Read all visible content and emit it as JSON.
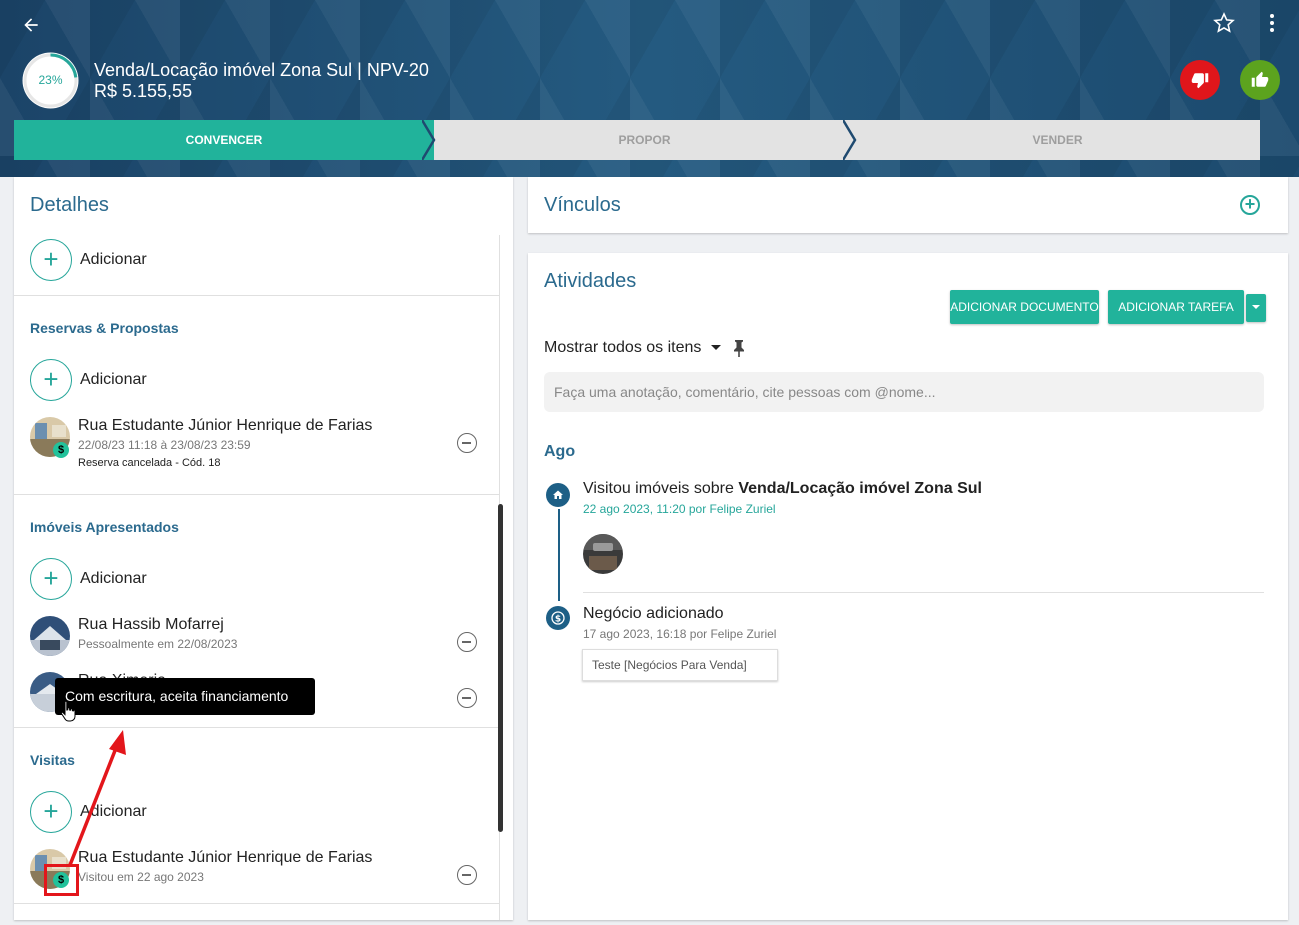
{
  "header": {
    "progress": "23%",
    "progress_fraction": 0.23,
    "deal_title": "Venda/Locação imóvel Zona Sul | NPV-20",
    "deal_value": "R$ 5.155,55",
    "icons": {
      "back": "arrow-back-icon",
      "favorite": "star-outline-icon",
      "more": "more-vertical-icon",
      "lose": "thumb-down-icon",
      "win": "thumb-up-icon"
    },
    "colors": {
      "lose": "#e0161b",
      "win": "#5ca31e",
      "accent": "#21b39b"
    }
  },
  "stages": [
    {
      "label": "CONVENCER",
      "active": true
    },
    {
      "label": "PROPOR",
      "active": false
    },
    {
      "label": "VENDER",
      "active": false
    }
  ],
  "details": {
    "title": "Detalhes",
    "add_label": "Adicionar",
    "reservas": {
      "title": "Reservas & Propostas",
      "add_label": "Adicionar",
      "items": [
        {
          "title": "Rua Estudante Júnior Henrique de Farias",
          "sub": "22/08/23 11:18 à 23/08/23 23:59",
          "note": "Reserva cancelada - Cód. 18"
        }
      ]
    },
    "imoveis": {
      "title": "Imóveis Apresentados",
      "add_label": "Adicionar",
      "items": [
        {
          "title": "Rua Hassib Mofarrej",
          "sub": "Pessoalmente em 22/08/2023"
        },
        {
          "title": "Rua Ximeria",
          "sub": ""
        }
      ]
    },
    "visitas": {
      "title": "Visitas",
      "add_label": "Adicionar",
      "items": [
        {
          "title": "Rua Estudante Júnior Henrique de Farias",
          "sub": "Visitou em 22 ago 2023"
        }
      ]
    },
    "tooltip": "Com escritura, aceita financiamento"
  },
  "vinculos": {
    "title": "Vínculos"
  },
  "atividades": {
    "title": "Atividades",
    "btn_documento": "ADICIONAR DOCUMENTO",
    "btn_tarefa": "ADICIONAR TAREFA",
    "filter": "Mostrar todos os itens",
    "note_placeholder": "Faça uma anotação, comentário, cite pessoas com @nome...",
    "period": "Ago",
    "timeline": [
      {
        "prefix": "Visitou imóveis sobre ",
        "bold": "Venda/Locação imóvel Zona Sul",
        "meta": "22 ago 2023, 11:20 por Felipe Zuriel",
        "icon": "home-icon"
      },
      {
        "prefix": "Negócio adicionado",
        "bold": "",
        "meta": "17 ago 2023, 16:18 por Felipe Zuriel",
        "icon": "dollar-icon",
        "chip": "Teste [Negócios Para Venda]"
      }
    ]
  }
}
